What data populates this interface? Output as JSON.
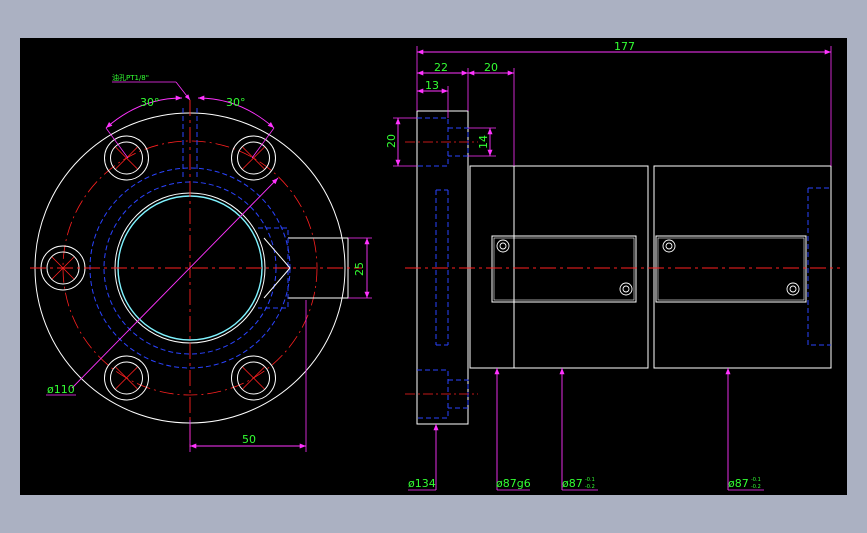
{
  "colors": {
    "background": "#abb1c2",
    "viewport": "#000000",
    "outline": "#ffffff",
    "hidden": "#2a43ff",
    "center": "#ff2020",
    "dimension": "#ff33ff",
    "dimension_text": "#33ff33",
    "highlight": "#7ff3ff"
  },
  "front_view": {
    "angle_left": "30°",
    "angle_right": "30°",
    "port_note": "油孔PT1/8\"",
    "dia_bolt_circle": "ø110",
    "dim_port_offset": "50",
    "dim_port_width": "25",
    "bolt_holes": 6
  },
  "side_view": {
    "dim_total_length": "177",
    "dim_flange_width": "22",
    "dim_body_offset": "20",
    "dim_hole_offset": "13",
    "dim_hole_height": "20",
    "dim_hole_small": "14",
    "dia_flange": "ø134",
    "dia_body_fit": "ø87g6",
    "dia_body_2": "ø87",
    "dia_body_2_tol_upper": "-0.1",
    "dia_body_2_tol_lower": "-0.2",
    "dia_body_3": "ø87",
    "dia_body_3_tol_upper": "-0.1",
    "dia_body_3_tol_lower": "-0.2"
  }
}
